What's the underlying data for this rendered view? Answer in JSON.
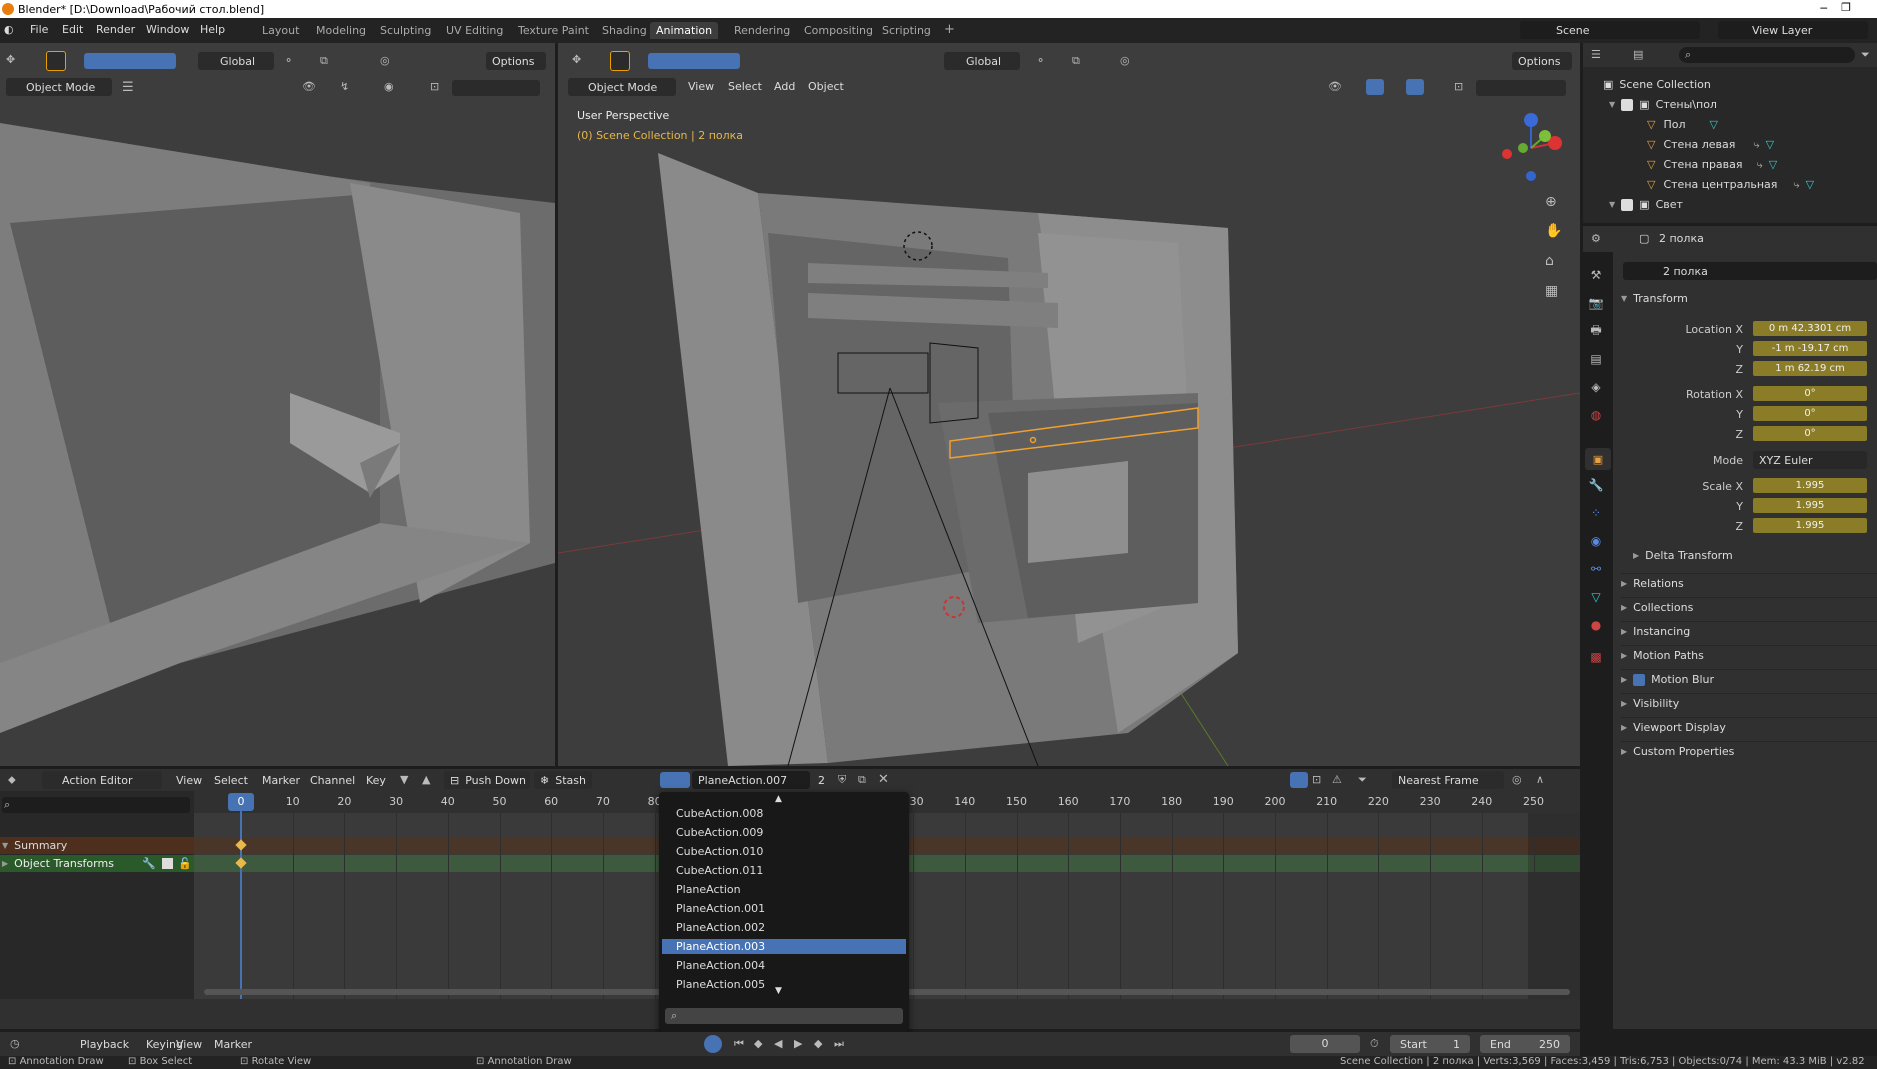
{
  "window": {
    "title": "Blender* [D:\\Download\\Рабочий стол.blend]"
  },
  "menus": {
    "file": "File",
    "edit": "Edit",
    "render": "Render",
    "window": "Window",
    "help": "Help"
  },
  "workspaces": [
    "Layout",
    "Modeling",
    "Sculpting",
    "UV Editing",
    "Texture Paint",
    "Shading",
    "Animation",
    "Rendering",
    "Compositing",
    "Scripting"
  ],
  "active_workspace": "Animation",
  "scene": {
    "name": "Scene",
    "view_layer": "View Layer"
  },
  "left_viewport": {
    "orientation": "Global",
    "options": "Options",
    "mode": "Object Mode"
  },
  "main_viewport": {
    "orientation": "Global",
    "options": "Options",
    "mode": "Object Mode",
    "menus": {
      "view": "View",
      "select": "Select",
      "add": "Add",
      "object": "Object"
    },
    "perspective": "User Perspective",
    "collection_info": "(0) Scene Collection | 2 полка"
  },
  "outliner": {
    "root": "Scene Collection",
    "items": [
      {
        "label": "Стены\\пол"
      },
      {
        "label": "Пол"
      },
      {
        "label": "Стена левая"
      },
      {
        "label": "Стена правая"
      },
      {
        "label": "Стена центральная"
      },
      {
        "label": "Свет"
      }
    ]
  },
  "properties": {
    "object_name": "2 полка",
    "object_field": "2 полка",
    "transform_header": "Transform",
    "location_x_label": "Location X",
    "location_x": "0 m 42.3301 cm",
    "location_y_label": "Y",
    "location_y": "-1 m -19.17 cm",
    "location_z_label": "Z",
    "location_z": "1 m 62.19 cm",
    "rotation_x_label": "Rotation X",
    "rotation_x": "0°",
    "rotation_y_label": "Y",
    "rotation_y": "0°",
    "rotation_z_label": "Z",
    "rotation_z": "0°",
    "mode_label": "Mode",
    "mode": "XYZ Euler",
    "scale_x_label": "Scale X",
    "scale_x": "1.995",
    "scale_y_label": "Y",
    "scale_y": "1.995",
    "scale_z_label": "Z",
    "scale_z": "1.995",
    "delta_transform": "Delta Transform",
    "panels": [
      "Relations",
      "Collections",
      "Instancing",
      "Motion Paths",
      "Motion Blur",
      "Visibility",
      "Viewport Display",
      "Custom Properties"
    ]
  },
  "action_editor": {
    "mode": "Action Editor",
    "menus": {
      "view": "View",
      "select": "Select",
      "marker": "Marker",
      "channel": "Channel",
      "key": "Key"
    },
    "push_down": "Push Down",
    "stash": "Stash",
    "action_name": "PlaneAction.007",
    "users": "2",
    "snap": "Nearest Frame",
    "channels": {
      "summary": "Summary",
      "object_transforms": "Object Transforms"
    },
    "frame_ticks": [
      "0",
      "10",
      "20",
      "30",
      "40",
      "50",
      "60",
      "70",
      "80",
      "130",
      "140",
      "150",
      "160",
      "170",
      "180",
      "190",
      "200",
      "210",
      "220",
      "230",
      "240",
      "250"
    ],
    "current_frame_label": "0"
  },
  "action_dropdown": {
    "items": [
      "CubeAction.008",
      "CubeAction.009",
      "CubeAction.010",
      "CubeAction.011",
      "PlaneAction",
      "PlaneAction.001",
      "PlaneAction.002",
      "PlaneAction.003",
      "PlaneAction.004",
      "PlaneAction.005"
    ],
    "selected": "PlaneAction.003"
  },
  "timeline": {
    "playback": "Playback",
    "keying": "Keying",
    "view": "View",
    "marker": "Marker",
    "current_frame": "0",
    "start_label": "Start",
    "start": "1",
    "end_label": "End",
    "end": "250"
  },
  "statusbar": {
    "annotation_draw": "Annotation Draw",
    "box_select": "Box Select",
    "rotate_view": "Rotate View",
    "annotation_draw_2": "Annotation Draw",
    "stats": "Scene Collection | 2 полка | Verts:3,569 | Faces:3,459 | Tris:6,753 | Objects:0/74 | Mem: 43.3 MiB | v2.82"
  },
  "colors": {
    "accent": "#4772b3",
    "field": "#8b7c27",
    "selection_orange": "#f0a030"
  }
}
